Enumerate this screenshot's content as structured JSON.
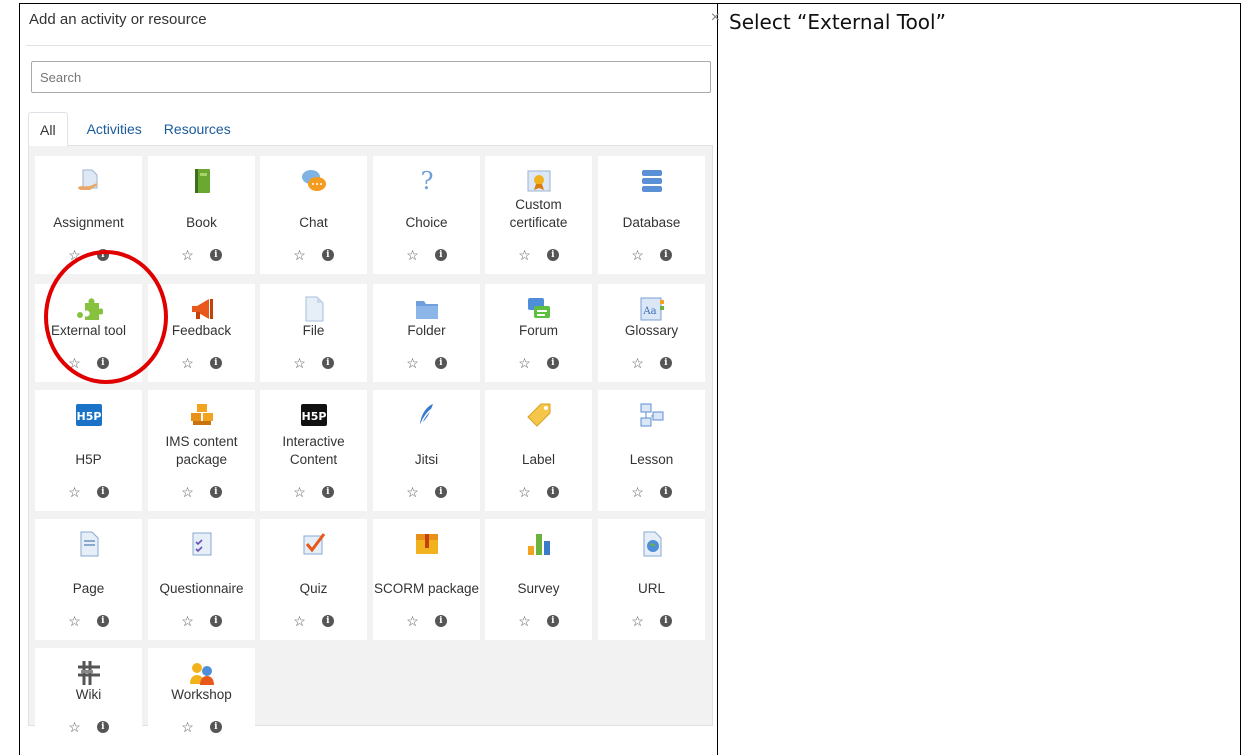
{
  "instruction": "Select “External Tool”",
  "modal": {
    "title": "Add an activity or resource",
    "close": "×",
    "search_placeholder": "Search",
    "tabs": [
      "All",
      "Activities",
      "Resources"
    ]
  },
  "icons": {
    "star": "☆",
    "info": "i"
  },
  "accent": "#e00000",
  "tiles": [
    {
      "label": "Assignment",
      "icon": "assignment-icon"
    },
    {
      "label": "Book",
      "icon": "book-icon"
    },
    {
      "label": "Chat",
      "icon": "chat-icon"
    },
    {
      "label": "Choice",
      "icon": "choice-icon"
    },
    {
      "label": "Custom certificate",
      "icon": "certificate-icon"
    },
    {
      "label": "Database",
      "icon": "database-icon"
    },
    {
      "label": "External tool",
      "icon": "puzzle-icon"
    },
    {
      "label": "Feedback",
      "icon": "megaphone-icon"
    },
    {
      "label": "File",
      "icon": "file-icon"
    },
    {
      "label": "Folder",
      "icon": "folder-icon"
    },
    {
      "label": "Forum",
      "icon": "forum-icon"
    },
    {
      "label": "Glossary",
      "icon": "glossary-icon"
    },
    {
      "label": "H5P",
      "icon": "h5p-icon"
    },
    {
      "label": "IMS content package",
      "icon": "ims-package-icon"
    },
    {
      "label": "Interactive Content",
      "icon": "h5p-dark-icon"
    },
    {
      "label": "Jitsi",
      "icon": "jitsi-icon"
    },
    {
      "label": "Label",
      "icon": "label-icon"
    },
    {
      "label": "Lesson",
      "icon": "lesson-icon"
    },
    {
      "label": "Page",
      "icon": "page-icon"
    },
    {
      "label": "Questionnaire",
      "icon": "questionnaire-icon"
    },
    {
      "label": "Quiz",
      "icon": "quiz-icon"
    },
    {
      "label": "SCORM package",
      "icon": "scorm-icon"
    },
    {
      "label": "Survey",
      "icon": "survey-icon"
    },
    {
      "label": "URL",
      "icon": "url-icon"
    },
    {
      "label": "Wiki",
      "icon": "wiki-icon"
    },
    {
      "label": "Workshop",
      "icon": "workshop-icon"
    }
  ]
}
